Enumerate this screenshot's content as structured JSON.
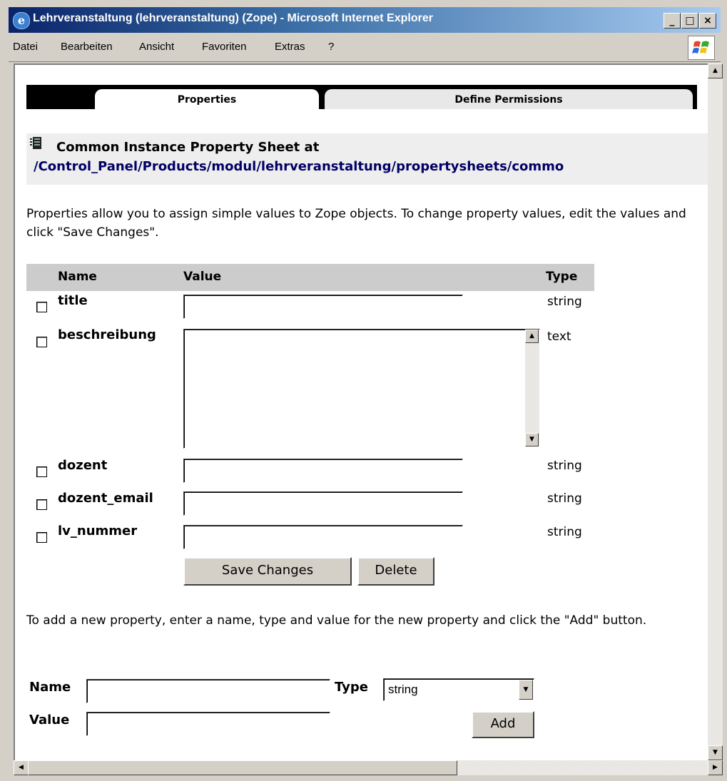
{
  "window": {
    "title": "Lehrveranstaltung (lehrveranstaltung) (Zope) - Microsoft Internet Explorer",
    "minimize": "_",
    "maximize": "□",
    "close": "×"
  },
  "menubar": {
    "items": [
      "Datei",
      "Bearbeiten",
      "Ansicht",
      "Favoriten",
      "Extras",
      "?"
    ]
  },
  "tabs": {
    "properties": "Properties",
    "define_permissions": "Define Permissions"
  },
  "sheet": {
    "title": "Common Instance Property Sheet at",
    "path": [
      {
        "text": "/"
      },
      {
        "text": "Control_Panel"
      },
      {
        "text": "/"
      },
      {
        "text": "Products"
      },
      {
        "text": "/"
      },
      {
        "text": "modul"
      },
      {
        "text": "/"
      },
      {
        "text": "lehrveranstaltung"
      },
      {
        "text": "/"
      },
      {
        "text": "propertysheets"
      },
      {
        "text": "/"
      },
      {
        "text": "commo"
      }
    ]
  },
  "intro": "Properties allow you to assign simple values to Zope objects. To change property values, edit the values and click \"Save Changes\".",
  "table": {
    "headers": {
      "name": "Name",
      "value": "Value",
      "type": "Type"
    },
    "rows": [
      {
        "name": "title",
        "value": "",
        "type": "string"
      },
      {
        "name": "beschreibung",
        "value": "",
        "type": "text"
      },
      {
        "name": "dozent",
        "value": "",
        "type": "string"
      },
      {
        "name": "dozent_email",
        "value": "",
        "type": "string"
      },
      {
        "name": "lv_nummer",
        "value": "",
        "type": "string"
      }
    ]
  },
  "buttons": {
    "save": "Save Changes",
    "delete": "Delete",
    "add": "Add"
  },
  "add_intro": "To add a new property, enter a name, type and value for the new property and click the \"Add\" button.",
  "add_form": {
    "name_label": "Name",
    "type_label": "Type",
    "value_label": "Value",
    "name_value": "",
    "value_value": "",
    "type_selected": "string"
  },
  "icons": {
    "app": "ie-icon",
    "sheet": "propertysheet-icon",
    "scroll_up": "▲",
    "scroll_down": "▼",
    "scroll_left": "◀",
    "scroll_right": "▶",
    "select_arrow": "▼"
  }
}
